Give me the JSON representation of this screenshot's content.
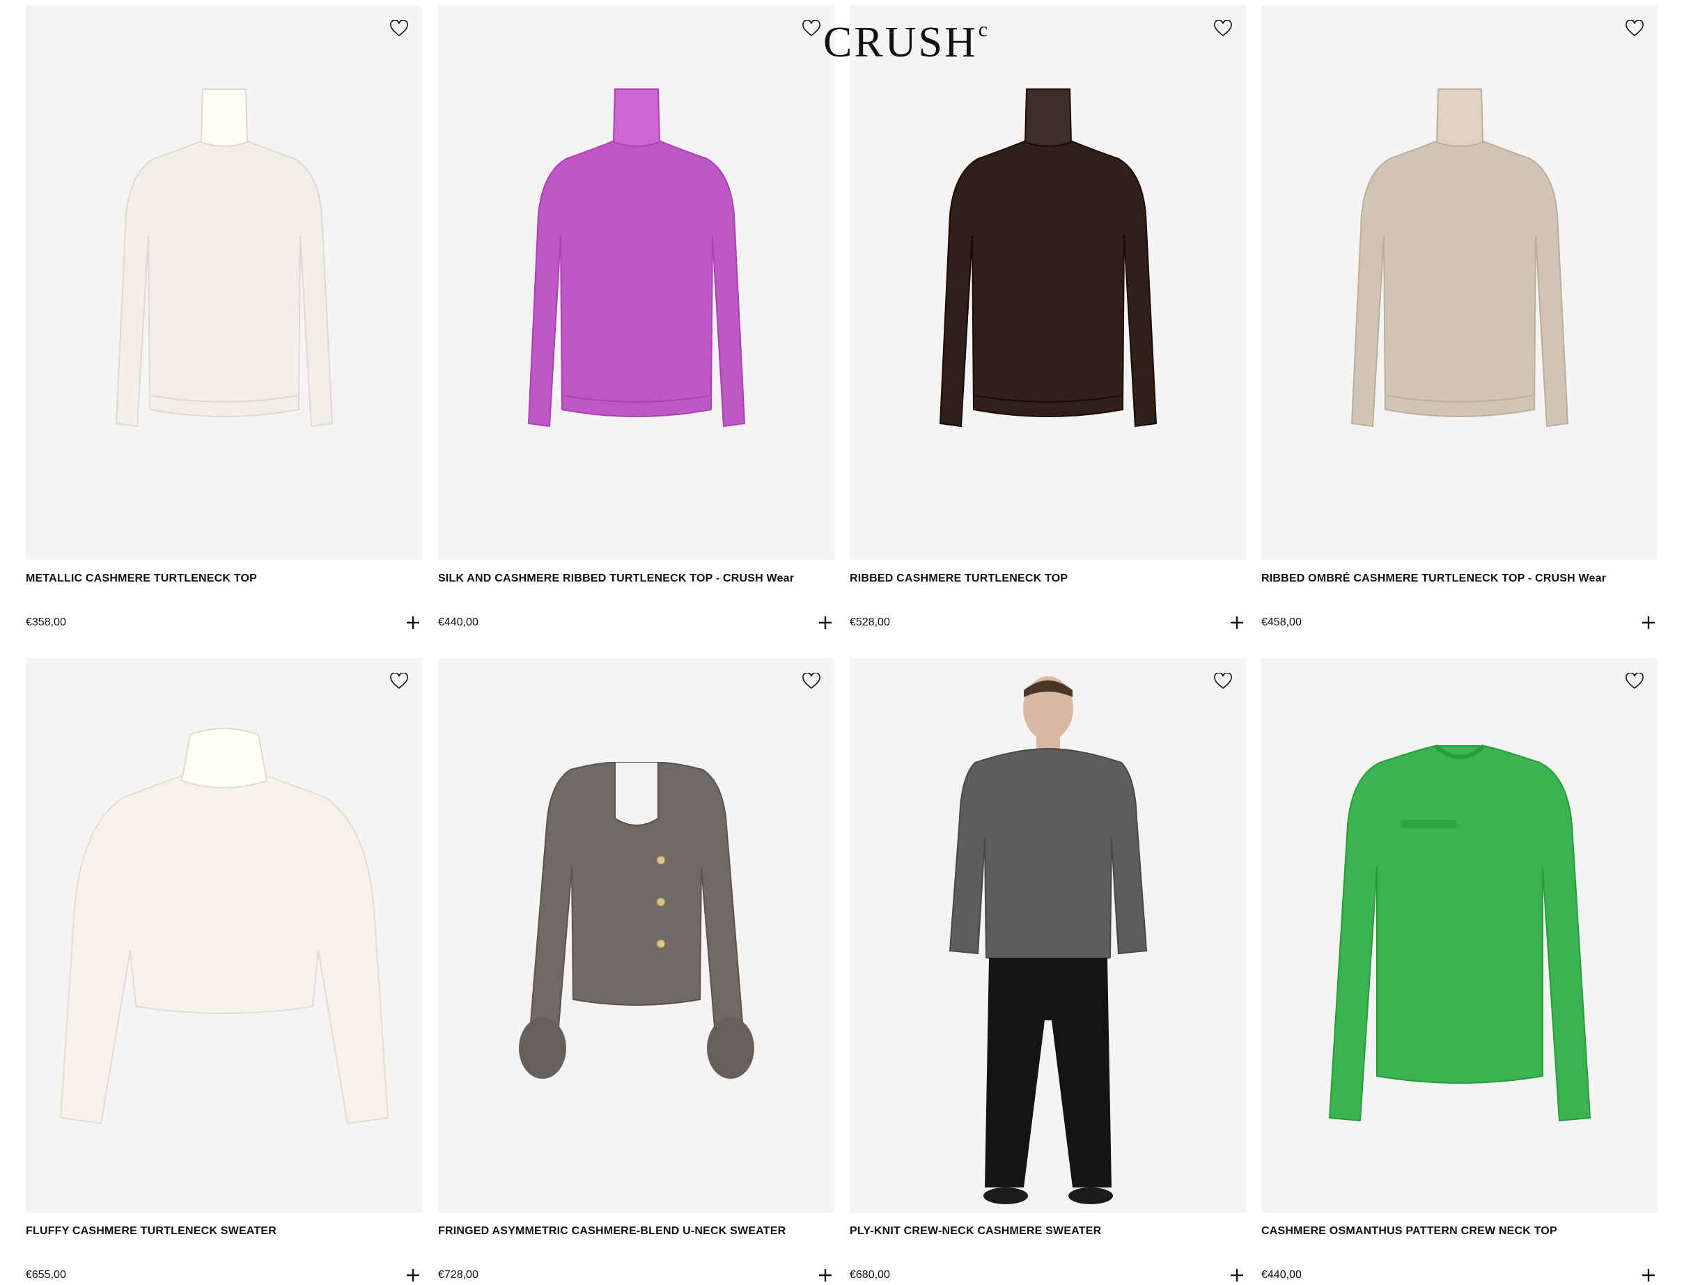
{
  "brand": {
    "name": "CRUSH",
    "mark": "c"
  },
  "products": [
    {
      "name": "METALLIC CASHMERE TURTLENECK TOP",
      "price": "€358,00",
      "color": "#f1efe8",
      "style": "turtleneck"
    },
    {
      "name": "SILK AND CASHMERE RIBBED TURTLENECK TOP - CRUSH Wear",
      "price": "€440,00",
      "color": "#c057c7",
      "style": "turtleneck"
    },
    {
      "name": "RIBBED CASHMERE TURTLENECK TOP",
      "price": "€528,00",
      "color": "#31201a",
      "style": "turtleneck"
    },
    {
      "name": "RIBBED OMBRÉ CASHMERE TURTLENECK TOP - CRUSH Wear",
      "price": "€458,00",
      "color": "#d1c4b3",
      "style": "turtleneck"
    },
    {
      "name": "FLUFFY CASHMERE TURTLENECK SWEATER",
      "price": "€655,00",
      "color": "#f6f2e9",
      "style": "fluffy"
    },
    {
      "name": "FRINGED ASYMMETRIC CASHMERE-BLEND U-NECK SWEATER",
      "price": "€728,00",
      "color": "#6f6a66",
      "style": "cardigan"
    },
    {
      "name": "PLY-KNIT CREW-NECK CASHMERE SWEATER",
      "price": "€680,00",
      "color": "#5d5d5d",
      "style": "model"
    },
    {
      "name": "CASHMERE OSMANTHUS PATTERN CREW NECK TOP",
      "price": "€440,00",
      "color": "#3bb352",
      "style": "crew"
    }
  ],
  "icons": {
    "wishlist": "heart-outline-icon",
    "add": "plus-icon"
  }
}
